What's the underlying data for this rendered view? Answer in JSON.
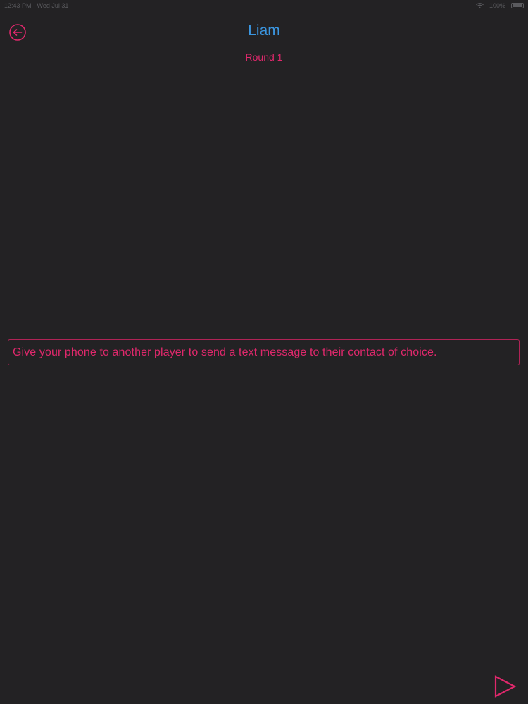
{
  "status_bar": {
    "time": "12:43 PM",
    "date": "Wed Jul 31",
    "battery": "100%"
  },
  "header": {
    "player_name": "Liam",
    "round_label": "Round 1"
  },
  "prompt": {
    "text": "Give your phone to another player to send a text message to their contact of choice."
  },
  "icons": {
    "back": "back-arrow-circle-icon",
    "next": "play-triangle-icon"
  },
  "colors": {
    "background": "#232224",
    "accent_pink": "#e0286c",
    "accent_blue": "#3b96e0"
  }
}
